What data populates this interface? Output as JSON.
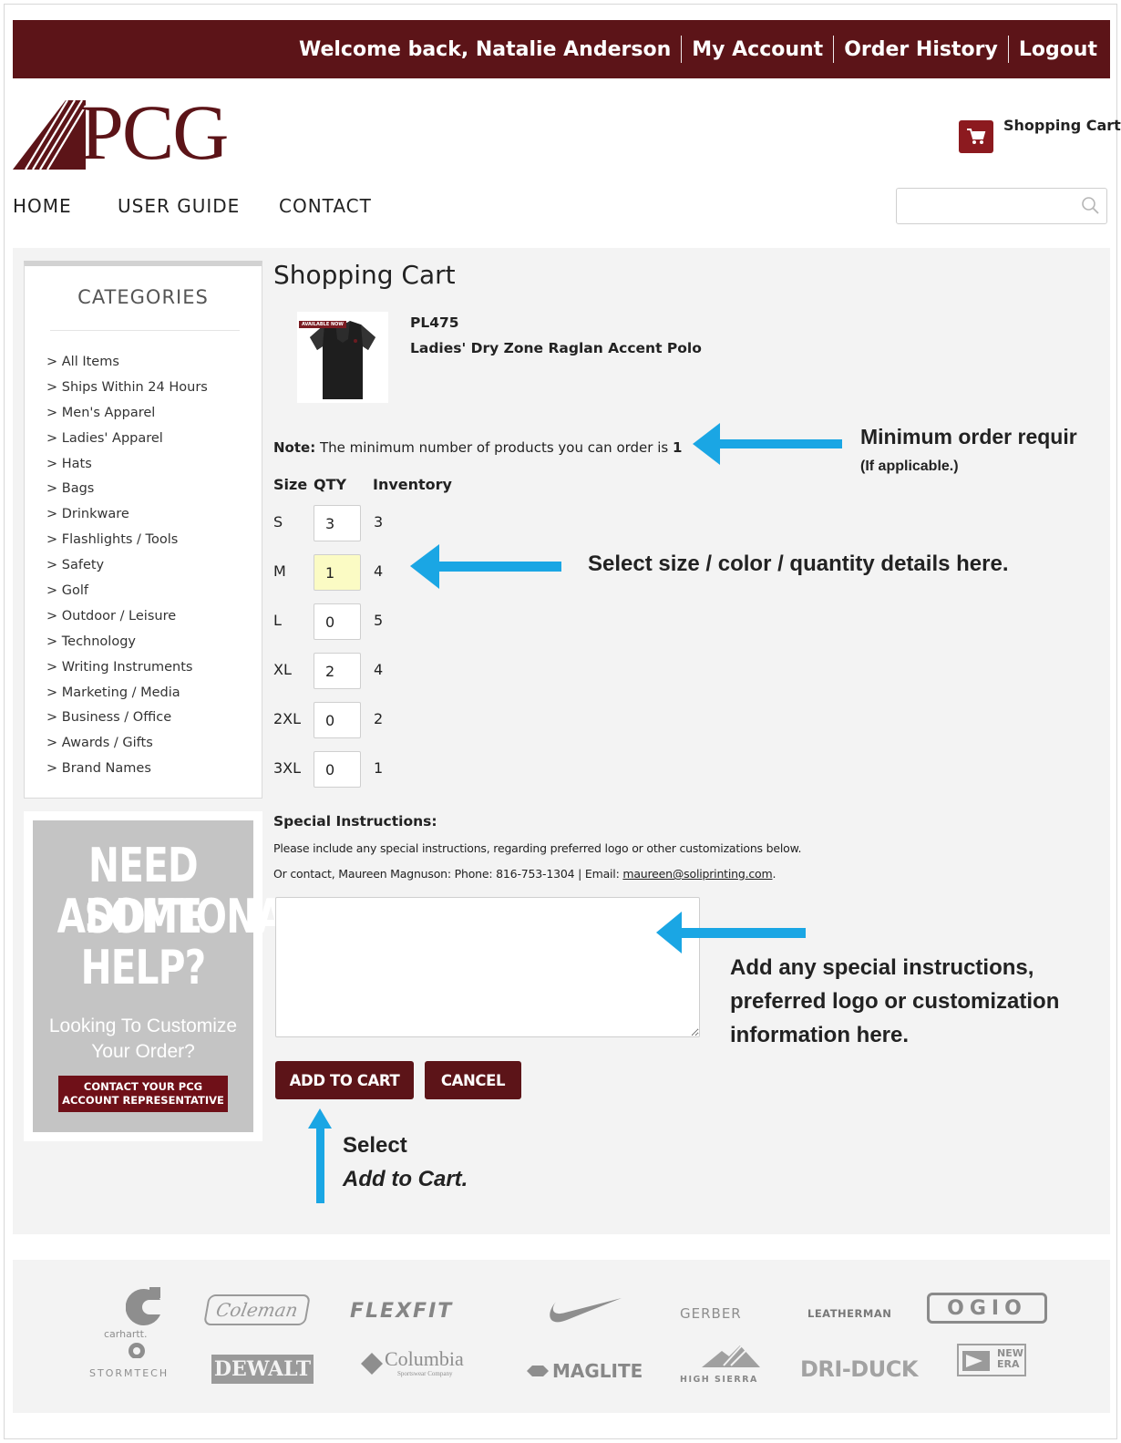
{
  "header": {
    "welcome": "Welcome back, Natalie Anderson",
    "my_account": "My Account",
    "order_history": "Order History",
    "logout": "Logout"
  },
  "logo": {
    "text": "PCG"
  },
  "cart": {
    "label": "Shopping Cart",
    "icon": "cart-icon"
  },
  "nav": {
    "home": "HOME",
    "user_guide": "USER GUIDE",
    "contact": "CONTACT"
  },
  "search": {
    "placeholder": "",
    "icon": "search-icon"
  },
  "sidebar": {
    "title": "CATEGORIES",
    "items": [
      "> All Items",
      "> Ships Within 24 Hours",
      "> Men's Apparel",
      "> Ladies' Apparel",
      "> Hats",
      "> Bags",
      "> Drinkware",
      "> Flashlights / Tools",
      "> Safety",
      "> Golf",
      "> Outdoor / Leisure",
      "> Technology",
      "> Writing Instruments",
      "> Marketing / Media",
      "> Business / Office",
      "> Awards / Gifts",
      "> Brand Names"
    ]
  },
  "help_banner": {
    "line1": "NEED SOME",
    "line2": "ADDITIONAL",
    "line3": "HELP?",
    "sub1": "Looking To Customize",
    "sub2": "Your Order?",
    "button_line1": "CONTACT YOUR PCG",
    "button_line2": "ACCOUNT REPRESENTATIVE"
  },
  "main": {
    "title": "Shopping Cart",
    "product": {
      "badge": "AVAILABLE NOW",
      "sku": "PL475",
      "name": "Ladies' Dry Zone Raglan Accent Polo"
    },
    "note_label": "Note:",
    "note_text": " The minimum number of products you can order is ",
    "note_min": "1",
    "table": {
      "headers": {
        "size": "Size",
        "qty": "QTY",
        "inventory": "Inventory"
      },
      "rows": [
        {
          "size": "S",
          "qty": "3",
          "inventory": "3"
        },
        {
          "size": "M",
          "qty": "1",
          "inventory": "4"
        },
        {
          "size": "L",
          "qty": "0",
          "inventory": "5"
        },
        {
          "size": "XL",
          "qty": "2",
          "inventory": "4"
        },
        {
          "size": "2XL",
          "qty": "0",
          "inventory": "2"
        },
        {
          "size": "3XL",
          "qty": "0",
          "inventory": "1"
        }
      ]
    },
    "special": {
      "heading": "Special Instructions:",
      "line1": "Please include any special instructions, regarding preferred logo or other customizations below.",
      "line2_prefix": "Or contact, Maureen Magnuson: Phone: 816-753-1304 | Email: ",
      "email": "maureen@soliprinting.com",
      "line2_suffix": ".",
      "value": ""
    },
    "buttons": {
      "add_to_cart": "ADD TO CART",
      "cancel": "CANCEL"
    }
  },
  "annotations": {
    "min_order": "Minimum order requir",
    "min_order_sub": "(If applicable.)",
    "select_details": "Select size / color / quantity details here.",
    "special_1": "Add any special instructions,",
    "special_2": "preferred logo or customization",
    "special_3": "information here.",
    "select_1": "Select",
    "select_2": "Add to Cart.",
    "arrow_color": "#1aa6e4"
  },
  "brands": {
    "carhartt": "carhartt.",
    "coleman": "Coleman",
    "flexfit": "FLEXFIT",
    "nike": "nike-swoosh",
    "gerber": "GERBER",
    "leatherman": "LEATHERMAN",
    "ogio": "OGIO",
    "stormtech": "STORMTECH",
    "dewalt": "DEWALT",
    "columbia": "Columbia",
    "columbia_sub": "Sportswear Company",
    "maglite": "MAGLITE",
    "high_sierra": "HIGH SIERRA",
    "dri_duck": "DRI-DUCK",
    "new_era_1": "NEW",
    "new_era_2": "ERA"
  },
  "colors": {
    "brand": "#5c1418",
    "accent": "#1aa6e4",
    "highlight": "#fbfbc4"
  }
}
